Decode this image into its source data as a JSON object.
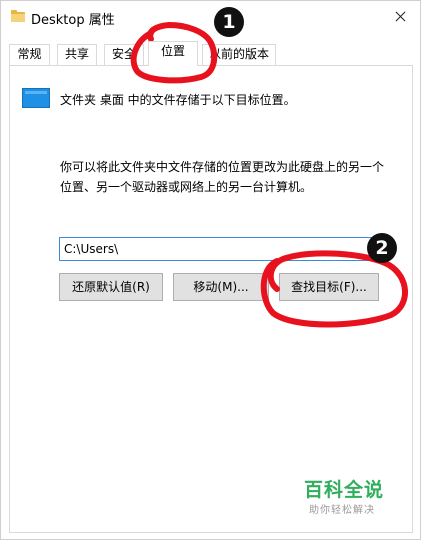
{
  "window": {
    "title": "Desktop 属性",
    "close_icon": "close-icon"
  },
  "tabs": [
    {
      "label": "常规",
      "active": false
    },
    {
      "label": "共享",
      "active": false
    },
    {
      "label": "安全",
      "active": false
    },
    {
      "label": "位置",
      "active": true
    },
    {
      "label": "以前的版本",
      "active": false
    }
  ],
  "location": {
    "folder_icon": "folder-icon",
    "info_text": "文件夹 桌面 中的文件存储于以下目标位置。",
    "description_line1": "你可以将此文件夹中文件存储的位置更改为此硬盘上的另一个",
    "description_line2": "位置、另一个驱动器或网络上的另一台计算机。",
    "path_value": "C:\\Users\\",
    "restore_default_label": "还原默认值(R)",
    "move_label": "移动(M)...",
    "find_target_label": "查找目标(F)..."
  },
  "annotations": {
    "badge1": "1",
    "badge2": "2",
    "highlight_color": "#e8121e"
  },
  "watermark": {
    "title": "百科全说",
    "subtitle": "助你轻松解决"
  }
}
